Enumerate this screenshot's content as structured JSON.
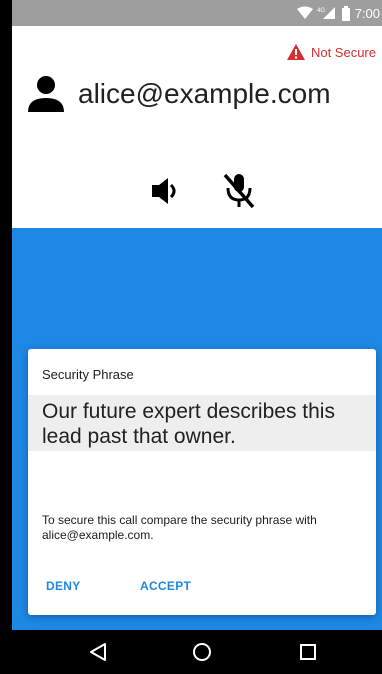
{
  "status_bar": {
    "time": "7:00",
    "icons": [
      "wifi-icon",
      "cellular-4g-icon",
      "battery-icon"
    ],
    "network_label": "4G"
  },
  "security": {
    "label": "Not Secure",
    "icon": "warning-icon",
    "color": "#d32f2f"
  },
  "call": {
    "peer": "alice@example.com",
    "avatar_icon": "person-icon",
    "speaker_icon": "speaker-icon",
    "mic_icon": "mic-off-icon"
  },
  "background_color": "#1e88e5",
  "dialog": {
    "title": "Security Phrase",
    "phrase": "Our future expert describes this lead past that owner.",
    "message": "To secure this call compare the security phrase with alice@example.com.",
    "deny_label": "DENY",
    "accept_label": "ACCEPT",
    "accent_color": "#1e88e5"
  },
  "nav_bar": {
    "buttons": [
      "back-icon",
      "home-icon",
      "recents-icon"
    ]
  }
}
